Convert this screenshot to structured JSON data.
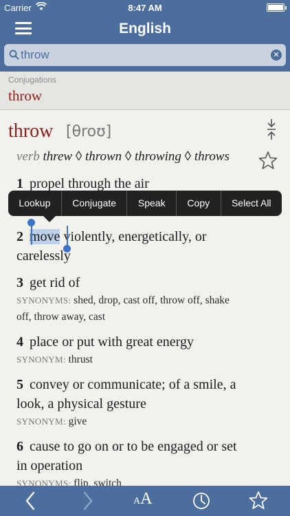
{
  "status_bar": {
    "carrier": "Carrier",
    "time": "8:47 AM"
  },
  "nav": {
    "title": "English"
  },
  "search": {
    "value": "throw"
  },
  "conjugations": {
    "label": "Conjugations",
    "word": "throw"
  },
  "entry": {
    "headword": "throw",
    "pronunciation": "[θroʊ]",
    "part_of_speech": "verb",
    "forms": "threw ◊ thrown ◊ throwing ◊ throws",
    "senses": [
      {
        "num": "1",
        "text": "propel through the air"
      },
      {
        "num": "2",
        "selected": "move",
        "rest": " violently, energetically, or",
        "line2": "carelessly"
      },
      {
        "num": "3",
        "text": "get rid of"
      },
      {
        "num": "4",
        "text": "place or put with great energy"
      },
      {
        "num": "5",
        "text": "convey or communicate; of a smile, a",
        "line2": "look, a physical gesture"
      },
      {
        "num": "6",
        "text": "cause to go on or to be engaged or set",
        "line2": "in operation"
      }
    ],
    "synonyms": [
      {
        "label": "SYNONYMS:",
        "text": "shed, drop, cast off, throw off, shake",
        "line2": "off, throw away, cast"
      },
      {
        "label": "SYNONYM:",
        "text": "thrust"
      },
      {
        "label": "SYNONYM:",
        "text": "give"
      },
      {
        "label": "SYNONYMS:",
        "text": "flip, switch"
      }
    ]
  },
  "context_menu": [
    "Lookup",
    "Conjugate",
    "Speak",
    "Copy",
    "Select All"
  ],
  "colors": {
    "bar": "#4c6e9c",
    "headword": "#8b1f17",
    "selection": "#3b73c9"
  },
  "toolbar_icons": [
    "back-arrow-icon",
    "forward-arrow-icon",
    "font-size-icon",
    "history-clock-icon",
    "favorites-star-icon"
  ]
}
